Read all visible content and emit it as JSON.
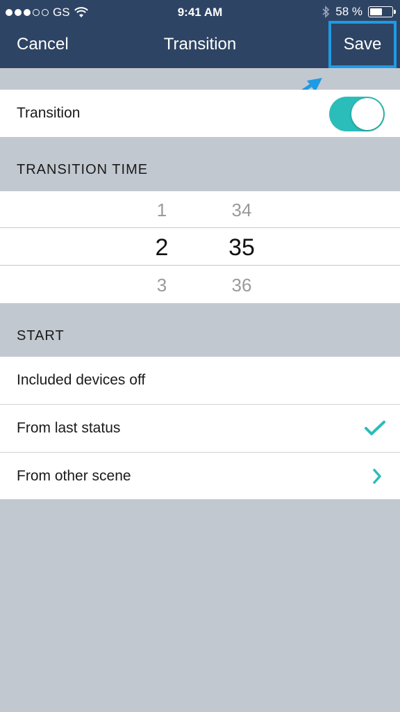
{
  "status_bar": {
    "carrier": "GS",
    "time": "9:41 AM",
    "battery": "58 %",
    "battery_level": 0.58
  },
  "nav": {
    "cancel_label": "Cancel",
    "title": "Transition",
    "save_label": "Save"
  },
  "transition_row": {
    "label": "Transition",
    "enabled": true
  },
  "transition_time": {
    "header": "TRANSITION TIME",
    "column1": [
      "1",
      "2",
      "3"
    ],
    "column2": [
      "34",
      "35",
      "36"
    ],
    "selected": [
      "2",
      "35"
    ]
  },
  "start": {
    "header": "START",
    "options": [
      {
        "label": "Included devices off"
      },
      {
        "label": "From last status",
        "selected": true
      },
      {
        "label": "From other scene",
        "has_submenu": true
      }
    ]
  },
  "colors": {
    "nav_bg": "#2e4464",
    "accent": "#2bbdb9",
    "highlight": "#1e9be4",
    "background": "#c2c8d0"
  }
}
